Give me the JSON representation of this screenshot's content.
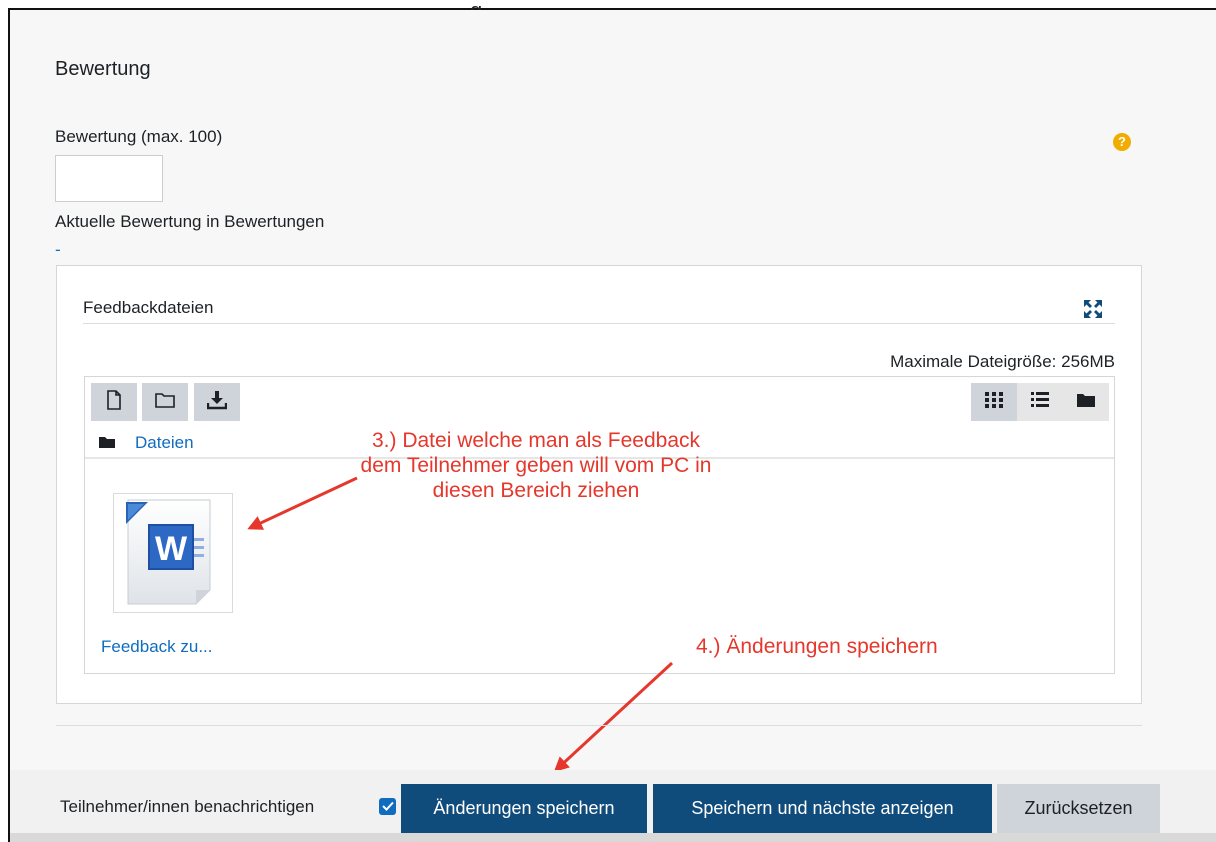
{
  "grading": {
    "section_title": "Bewertung",
    "grade_label": "Bewertung (max. 100)",
    "grade_value": "",
    "help_icon": "question-circle-icon",
    "current_grade_label": "Aktuelle Bewertung in Bewertungen",
    "current_grade_value": "-"
  },
  "feedback_files": {
    "label": "Feedbackdateien",
    "max_size": "Maximale Dateigröße: 256MB",
    "toolbar": {
      "add_file_icon": "file-icon",
      "create_folder_icon": "folder-icon",
      "download_icon": "download-icon",
      "view_icons": "grid-icon",
      "view_list": "list-icon",
      "view_tree": "folder-solid-icon"
    },
    "path_link": "Dateien",
    "files": [
      {
        "name": "Feedback zu...",
        "type_icon": "word-document-icon"
      }
    ]
  },
  "annotations": {
    "step3": "3.) Datei welche man als Feedback dem Teilnehmer geben will vom PC in diesen Bereich ziehen",
    "step4": "4.) Änderungen speichern",
    "color": "#e5372b"
  },
  "footer": {
    "notify_label": "Teilnehmer/innen benachrichtigen",
    "notify_checked": true,
    "save_button": "Änderungen speichern",
    "save_next_button": "Speichern und nächste anzeigen",
    "reset_button": "Zurücksetzen"
  },
  "colors": {
    "primary": "#0f4c7c",
    "link": "#0f6cbf",
    "help": "#f0ad00"
  }
}
